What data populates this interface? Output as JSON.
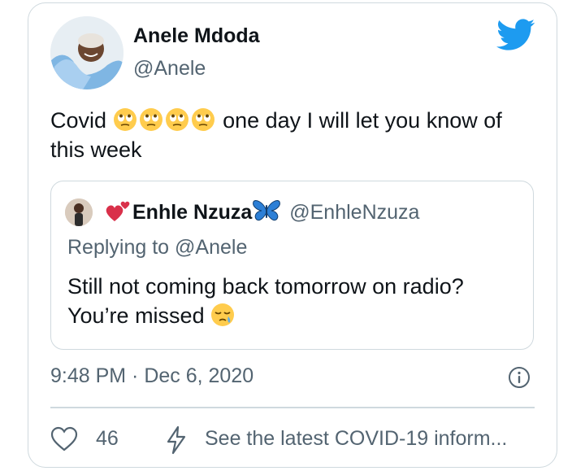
{
  "tweet": {
    "author_name": "Anele Mdoda",
    "author_handle": "@Anele",
    "text_before": "Covid",
    "text_after": "one day I will let you know of this week",
    "emoji_count": 4,
    "timestamp": "9:48 PM · Dec 6, 2020",
    "likes": "46",
    "covid_link": "See the latest COVID-19 inform..."
  },
  "quote": {
    "author_name": "Enhle Nzuza",
    "author_handle": "@EnhleNzuza",
    "replying_prefix": "Replying to",
    "replying_to": "@Anele",
    "text": "Still not coming back tomorrow on radio? You’re missed"
  },
  "icons": {
    "logo": "twitter-bird-icon",
    "info": "info-icon",
    "like": "heart-outline-icon",
    "covid": "lightning-bolt-icon"
  },
  "colors": {
    "twitter_blue": "#1d9bf0",
    "secondary_text": "#536471",
    "border": "#cfd9de",
    "butterfly": "#2c7fd6",
    "heart_emoji": "#d9304a"
  }
}
